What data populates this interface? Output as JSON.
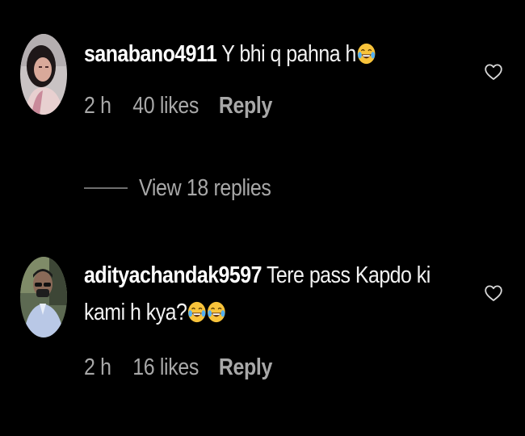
{
  "comments": [
    {
      "username": "sanabano4911",
      "text": "Y bhi q pahna h",
      "emoji_count": 1,
      "time": "2 h",
      "likes": "40 likes",
      "reply_label": "Reply",
      "avatar_icon": "profile-photo"
    },
    {
      "username": "adityachandak9597",
      "text_line1": "Tere pass Kapdo ki",
      "text_line2": "kami h kya?",
      "emoji_count": 2,
      "time": "2 h",
      "likes": "16 likes",
      "reply_label": "Reply",
      "avatar_icon": "profile-photo"
    }
  ],
  "view_replies": "View 18 replies",
  "icons": {
    "like": "heart-outline-icon",
    "emoji": "tears-of-joy-emoji"
  },
  "colors": {
    "background": "#000000",
    "primary_text": "#f5f5f5",
    "secondary_text": "#a8a8a8"
  }
}
